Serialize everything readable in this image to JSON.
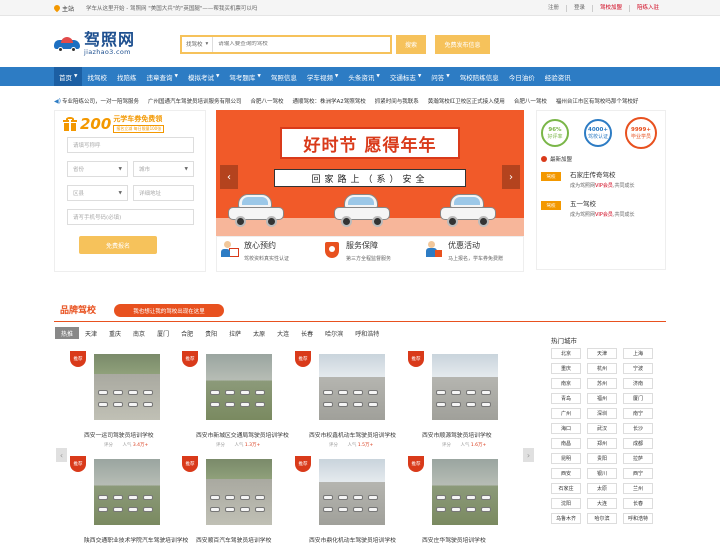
{
  "topbar": {
    "home": "主站",
    "slogan": "学车从这里开始 - 驾照网 \"美国大兵\"的\"英国腿\"——帮我买机票可以吗",
    "links": [
      "注册",
      "登录",
      "驾校加盟",
      "陪练入驻"
    ]
  },
  "header": {
    "logo_cn": "驾照网",
    "logo_en": "jiazhao3.com",
    "search_type": "找驾校",
    "search_placeholder": "请输入要查询的驾校",
    "search_button": "搜索",
    "publish_button": "免费发布信息"
  },
  "nav": [
    "首页",
    "找驾校",
    "找陪练",
    "违章查询",
    "模拟考试",
    "驾考题库",
    "驾照信息",
    "学车视频",
    "头条资讯",
    "交通标志",
    "问答",
    "驾校陪练信息",
    "今日油价",
    "经验资讯"
  ],
  "nav_caret": [
    "首页",
    "违章查询",
    "模拟考试",
    "驾考题库",
    "学车视频",
    "头条资讯",
    "交通标志",
    "问答"
  ],
  "ticker": [
    "专业陪练公司，一对一陪驾服务",
    "广州国通汽车驾驶员培训服务有限公司",
    "合肥八一驾校",
    "通顺驾校：株洲学A2驾照驾校",
    "抓紧时间与我联系",
    "黄瀚驾校红卫校区正式接入使用",
    "合肥八一驾校",
    "福州台江市区有驾校吗那个驾校好"
  ],
  "form": {
    "gift_amount": "200",
    "gift_line1": "元学车券免费领",
    "gift_line2": "报名立减  每日限量100张",
    "name_placeholder": "请填写称呼",
    "province": "省份",
    "city": "城市",
    "district": "区县",
    "address_placeholder": "详细地址",
    "phone_placeholder": "请写手机号码(必填)",
    "submit": "免费报名"
  },
  "banner": {
    "headline": "好时节 愿得年年",
    "road_sign": "回家路上（系）安全",
    "prev": "‹",
    "next": "›"
  },
  "features": [
    {
      "title": "放心预约",
      "sub": "驾校资料真实性认证"
    },
    {
      "title": "服务保障",
      "sub": "第三方全程监督服务"
    },
    {
      "title": "优惠活动",
      "sub": "马上报名，学车券免费赠"
    }
  ],
  "stats": [
    {
      "value": "96%",
      "label": "好评率",
      "color": "#7ab648"
    },
    {
      "value": "4000+",
      "label": "驾校认证",
      "color": "#2d7cc4"
    },
    {
      "value": "9999+",
      "label": "毕业学员",
      "color": "#e8511f"
    }
  ],
  "latest": {
    "title": "最新加盟",
    "items": [
      {
        "tag": "驾校",
        "name": "石家庄传奇驾校",
        "desc_pre": "成为驾照网",
        "desc_red": "VIP会员",
        "desc_post": ",共同成长"
      },
      {
        "tag": "驾校",
        "name": "五一驾校",
        "desc_pre": "成为驾照网",
        "desc_red": "VIP会员",
        "desc_post": ",共同成长"
      }
    ]
  },
  "brand": {
    "title": "品牌驾校",
    "cta": "我也想让我的驾校出现在这里",
    "cities": [
      "热推",
      "天津",
      "重庆",
      "南京",
      "厦门",
      "合肥",
      "贵阳",
      "拉萨",
      "太原",
      "大连",
      "长春",
      "哈尔滨",
      "呼和浩特"
    ]
  },
  "hot_cities": {
    "title": "热门城市",
    "items": [
      "北京",
      "天津",
      "上海",
      "重庆",
      "杭州",
      "宁波",
      "南京",
      "苏州",
      "济南",
      "青岛",
      "福州",
      "厦门",
      "广州",
      "深圳",
      "南宁",
      "海口",
      "武汉",
      "长沙",
      "南昌",
      "郑州",
      "成都",
      "昆明",
      "贵阳",
      "拉萨",
      "西安",
      "银川",
      "西宁",
      "石家庄",
      "太原",
      "兰州",
      "沈阳",
      "大连",
      "长春",
      "乌鲁木齐",
      "哈尔滨",
      "呼和浩特"
    ]
  },
  "schools": [
    {
      "badge": "推荐",
      "name": "西安一运司驾驶员培训学校",
      "label": "评分",
      "pop": "人气",
      "hits": "3.4万+"
    },
    {
      "badge": "推荐",
      "name": "西安市新城区交通局驾驶员培训学校",
      "label": "评分",
      "pop": "人气",
      "hits": "1.3万+"
    },
    {
      "badge": "推荐",
      "name": "西安市权鑫机动车驾驶员培训学校",
      "label": "评分",
      "pop": "人气",
      "hits": "1.5万+"
    },
    {
      "badge": "推荐",
      "name": "西安市顺源驾驶员培训学校",
      "label": "评分",
      "pop": "人气",
      "hits": "1.6万+"
    },
    {
      "badge": "推荐",
      "name": "陕西交通职业技术学院汽车驾驶培训学校"
    },
    {
      "badge": "推荐",
      "name": "西安顺百汽车驾驶员培训学校"
    },
    {
      "badge": "推荐",
      "name": "西安市鼎化机动车驾驶员培训学校"
    },
    {
      "badge": "推荐",
      "name": "西安庄华驾驶员培训学校"
    }
  ],
  "pager": {
    "prev": "‹",
    "next": "›"
  },
  "colors": {
    "nav": "#2d7cc4",
    "accent": "#f6c25b",
    "brand": "#e8511f"
  }
}
